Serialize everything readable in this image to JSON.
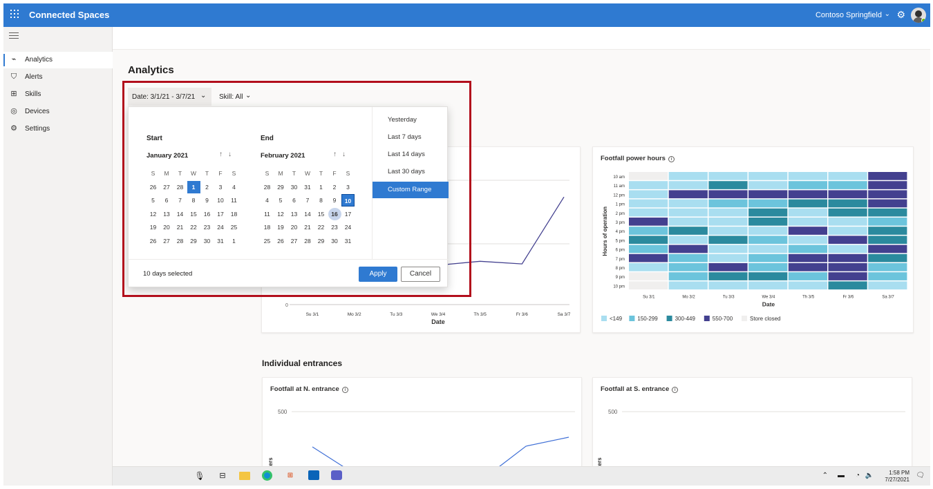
{
  "app": {
    "title": "Connected Spaces",
    "tenant": "Contoso Springfield"
  },
  "sidebar": {
    "items": [
      {
        "label": "Analytics",
        "icon": "chart-icon",
        "glyph": "⌁"
      },
      {
        "label": "Alerts",
        "icon": "shield-icon",
        "glyph": "⛉"
      },
      {
        "label": "Skills",
        "icon": "skills-icon",
        "glyph": "⊞"
      },
      {
        "label": "Devices",
        "icon": "camera-icon",
        "glyph": "◎"
      },
      {
        "label": "Settings",
        "icon": "gear-icon",
        "glyph": "⚙"
      }
    ]
  },
  "page": {
    "title": "Analytics",
    "date_filter": "Date: 3/1/21 - 3/7/21",
    "skill_filter": "Skill: All",
    "section_title": "Individual entrances"
  },
  "date_picker": {
    "start": {
      "heading": "Start",
      "month": "January 2021",
      "dow": [
        "S",
        "M",
        "T",
        "W",
        "T",
        "F",
        "S"
      ],
      "weeks": [
        [
          "26",
          "27",
          "28",
          "1",
          "2",
          "3",
          "4"
        ],
        [
          "5",
          "6",
          "7",
          "8",
          "9",
          "10",
          "11"
        ],
        [
          "12",
          "13",
          "14",
          "15",
          "16",
          "17",
          "18"
        ],
        [
          "19",
          "20",
          "21",
          "22",
          "23",
          "24",
          "25"
        ],
        [
          "26",
          "27",
          "28",
          "29",
          "30",
          "31",
          "1"
        ]
      ],
      "selected": "1"
    },
    "end": {
      "heading": "End",
      "month": "February 2021",
      "dow": [
        "S",
        "M",
        "T",
        "W",
        "T",
        "F",
        "S"
      ],
      "weeks": [
        [
          "28",
          "29",
          "30",
          "31",
          "1",
          "2",
          "3"
        ],
        [
          "4",
          "5",
          "6",
          "7",
          "8",
          "9",
          "10"
        ],
        [
          "11",
          "12",
          "13",
          "14",
          "15",
          "16",
          "17"
        ],
        [
          "18",
          "19",
          "20",
          "21",
          "22",
          "23",
          "24"
        ],
        [
          "25",
          "26",
          "27",
          "28",
          "29",
          "30",
          "31"
        ]
      ],
      "selected": "10",
      "today": "16"
    },
    "ranges": [
      "Yesterday",
      "Last 7 days",
      "Last 14 days",
      "Last 30 days",
      "Custom Range"
    ],
    "active_range": "Custom Range",
    "days_selected": "10 days selected",
    "apply": "Apply",
    "cancel": "Cancel"
  },
  "line_card": {
    "x_labels": [
      "Su 3/1",
      "Mo 3/2",
      "Tu 3/3",
      "We 3/4",
      "Th 3/5",
      "Fr 3/6",
      "Sa 3/7"
    ],
    "xlabel": "Date",
    "y_zero": "0",
    "values": [
      null,
      null,
      null,
      0.3,
      0.33,
      0.31,
      0.82
    ]
  },
  "heatmap": {
    "title": "Footfall power hours",
    "ylabel": "Hours of operation",
    "xlabel": "Date",
    "rows": [
      "10 am",
      "11 am",
      "12 pm",
      "1 pm",
      "2 pm",
      "3 pm",
      "4 pm",
      "5 pm",
      "6 pm",
      "7 pm",
      "8 pm",
      "9 pm",
      "10 pm"
    ],
    "cols": [
      "Su 3/1",
      "Mo 3/2",
      "Tu 3/3",
      "We 3/4",
      "Th 3/5",
      "Fr 3/6",
      "Sa 3/7"
    ],
    "legend": [
      {
        "label": "<149",
        "color": "#a9def0"
      },
      {
        "label": "150-299",
        "color": "#6cc4dc"
      },
      {
        "label": "300-449",
        "color": "#2b8a9e"
      },
      {
        "label": "550-700",
        "color": "#43408f"
      },
      {
        "label": "Store closed",
        "color": "#f0efee"
      }
    ],
    "cells": [
      [
        4,
        0,
        0,
        0,
        0,
        0,
        3
      ],
      [
        0,
        0,
        2,
        0,
        1,
        1,
        3
      ],
      [
        0,
        3,
        3,
        3,
        3,
        3,
        3
      ],
      [
        0,
        0,
        1,
        1,
        2,
        2,
        3
      ],
      [
        0,
        0,
        0,
        2,
        0,
        2,
        2
      ],
      [
        3,
        0,
        0,
        2,
        0,
        0,
        1
      ],
      [
        1,
        2,
        0,
        0,
        3,
        0,
        2
      ],
      [
        2,
        0,
        2,
        1,
        0,
        3,
        2
      ],
      [
        1,
        3,
        0,
        0,
        1,
        0,
        3
      ],
      [
        3,
        1,
        0,
        1,
        3,
        3,
        2
      ],
      [
        0,
        1,
        3,
        1,
        3,
        3,
        1
      ],
      [
        4,
        1,
        2,
        2,
        1,
        3,
        1
      ],
      [
        4,
        0,
        0,
        0,
        0,
        2,
        0
      ]
    ]
  },
  "entrance_n": {
    "title": "Footfall at N. entrance",
    "y_tick": "500",
    "ylabel_fragment": "nters"
  },
  "entrance_s": {
    "title": "Footfall at S. entrance",
    "y_tick": "500",
    "ylabel_fragment": "nters"
  },
  "taskbar": {
    "time": "1:58 PM",
    "date": "7/27/2021"
  },
  "colors": {
    "accent": "#2f7ad1",
    "highlight": "#b20e1c"
  }
}
